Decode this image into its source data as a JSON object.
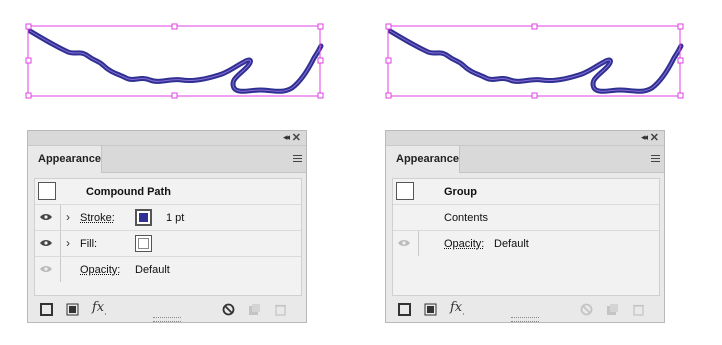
{
  "artboard": {
    "selection_color": "#e040e0",
    "stroke_color": "#2e3192",
    "highlight_color": "#8c6cd8"
  },
  "left_panel": {
    "tab_label": "Appearance",
    "collapse_glyph": "◂◂",
    "close_glyph": "✕",
    "rows": {
      "title": "Compound Path",
      "stroke_label": "Stroke:",
      "stroke_value": "1 pt",
      "fill_label": "Fill:",
      "opacity_label": "Opacity:",
      "opacity_value": "Default"
    },
    "stroke_color": "#2e3192"
  },
  "right_panel": {
    "tab_label": "Appearance",
    "collapse_glyph": "◂◂",
    "close_glyph": "✕",
    "rows": {
      "title": "Group",
      "contents_label": "Contents",
      "opacity_label": "Opacity:",
      "opacity_value": "Default"
    }
  },
  "toolbar_icons": [
    "add-new-stroke-icon",
    "add-new-fill-icon",
    "add-new-effect-icon",
    "clear-appearance-icon",
    "duplicate-item-icon",
    "delete-item-icon"
  ],
  "fx": {
    "main": "fx",
    "sub": "."
  }
}
